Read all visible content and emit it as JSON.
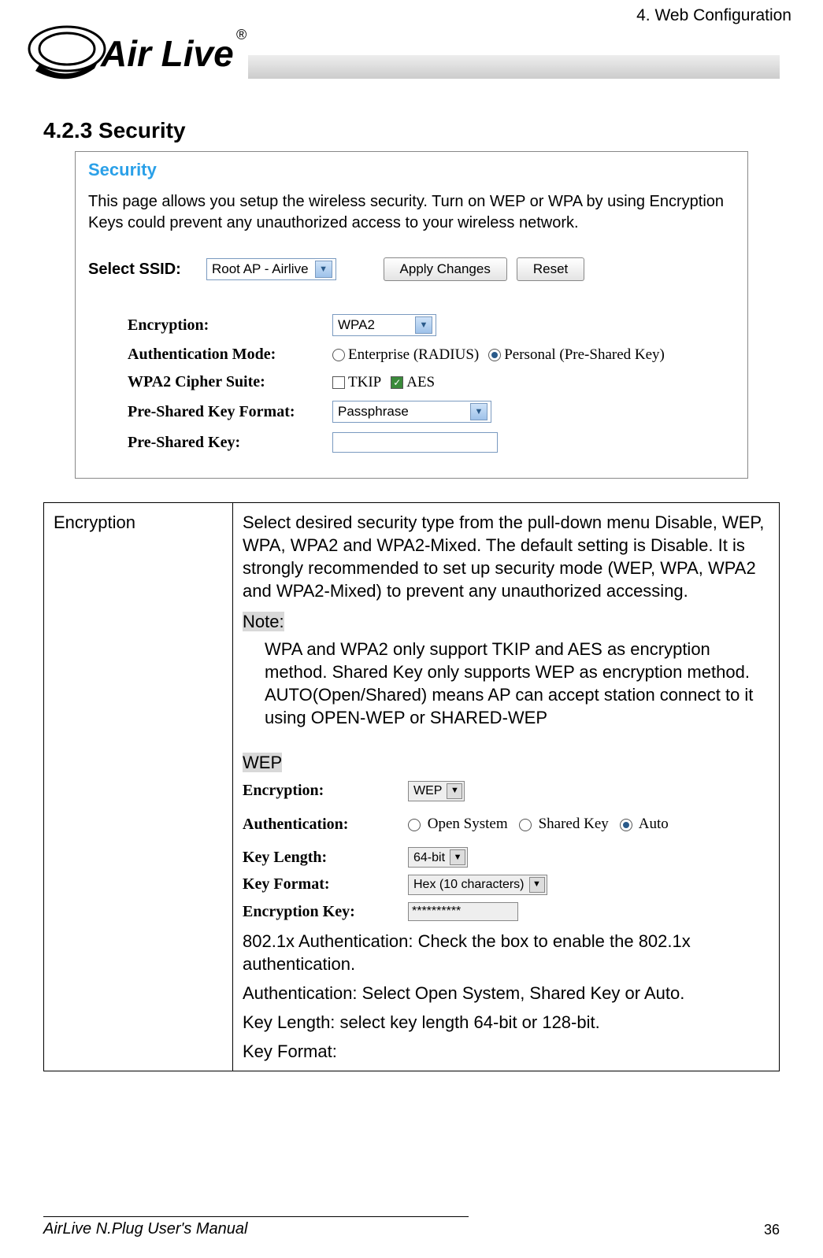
{
  "header_right": "4. Web Configuration",
  "logo_text_main": "Air Live",
  "logo_reg": "®",
  "section_heading": "4.2.3 Security",
  "shot1": {
    "title": "Security",
    "desc": "This page allows you setup the wireless security. Turn on WEP or WPA by using Encryption Keys could prevent any unauthorized access to your wireless network.",
    "select_ssid_label": "Select SSID:",
    "select_ssid_value": "Root AP - Airlive",
    "apply_btn": "Apply Changes",
    "reset_btn": "Reset",
    "encryption_label": "Encryption:",
    "encryption_value": "WPA2",
    "auth_mode_label": "Authentication Mode:",
    "auth_opt1": "Enterprise (RADIUS)",
    "auth_opt2": "Personal (Pre-Shared Key)",
    "cipher_label": "WPA2 Cipher Suite:",
    "cipher_tkip": "TKIP",
    "cipher_aes": "AES",
    "psk_format_label": "Pre-Shared Key Format:",
    "psk_format_value": "Passphrase",
    "psk_label": "Pre-Shared Key:"
  },
  "table": {
    "row1_label": "Encryption",
    "row1_p1": "Select desired security type from the pull-down menu Disable, WEP, WPA, WPA2 and WPA2-Mixed. The default setting is Disable. It is strongly recommended to set up security mode (WEP, WPA, WPA2 and WPA2-Mixed) to prevent any unauthorized accessing.",
    "note_label": "Note:",
    "note_body": "WPA and WPA2 only support TKIP and AES as encryption method. Shared Key only supports WEP as encryption method. AUTO(Open/Shared) means AP can accept station connect to it using OPEN-WEP or SHARED-WEP",
    "wep_heading": "WEP",
    "p_8021x": "802.1x Authentication: Check the box to enable the 802.1x authentication.",
    "p_auth": "Authentication: Select Open System, Shared Key or Auto.",
    "p_keylen": "Key Length: select key length 64-bit or 128-bit.",
    "p_keyfmt": "Key Format:"
  },
  "shot2": {
    "enc_label": "Encryption:",
    "enc_value": "WEP",
    "auth_label": "Authentication:",
    "auth_open": "Open System",
    "auth_shared": "Shared Key",
    "auth_auto": "Auto",
    "keylen_label": "Key Length:",
    "keylen_value": "64-bit",
    "keyfmt_label": "Key Format:",
    "keyfmt_value": "Hex (10 characters)",
    "enckey_label": "Encryption Key:",
    "enckey_value": "**********"
  },
  "footer_left": "AirLive N.Plug User's Manual",
  "page_number": "36"
}
